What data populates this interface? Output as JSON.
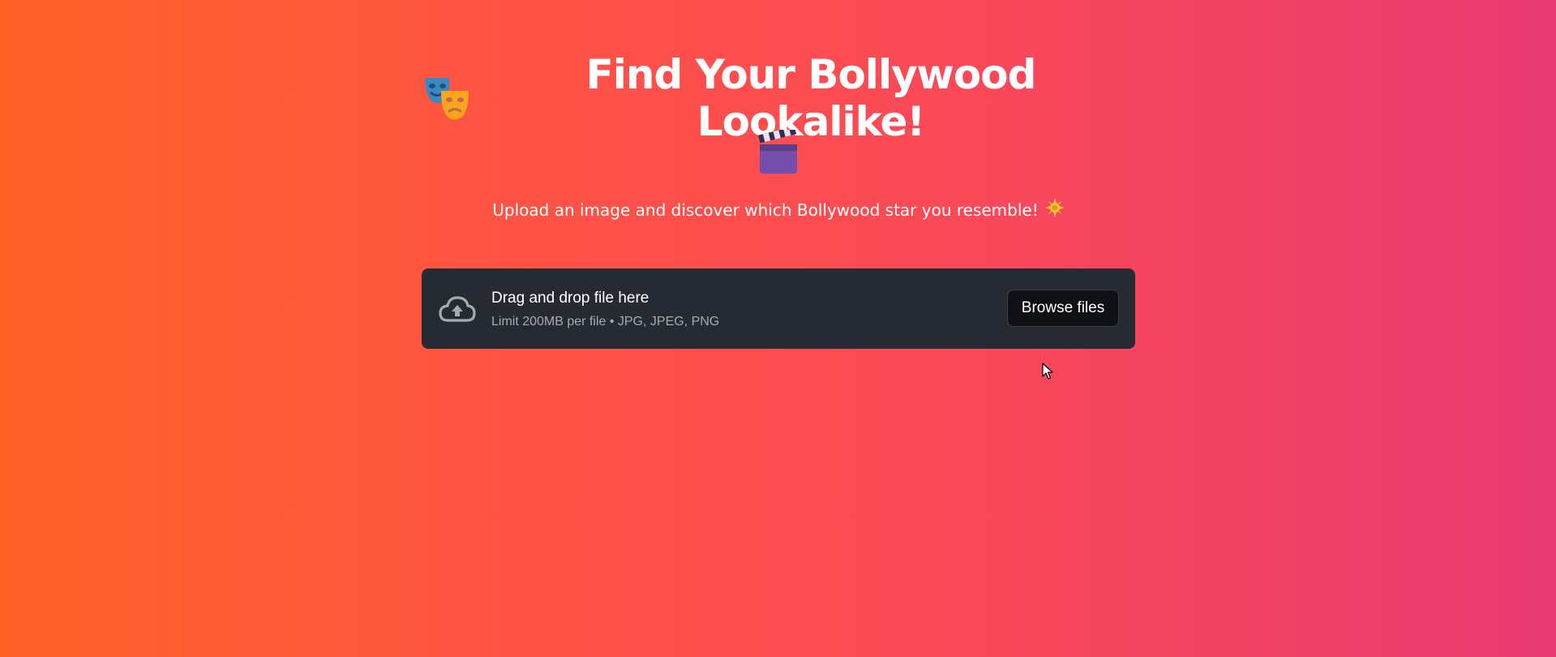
{
  "header": {
    "title": "Find Your Bollywood Lookalike!",
    "title_icon": "performing-arts-masks-icon",
    "title_trailing_icon": "clapper-board-icon"
  },
  "subtitle": {
    "text": "Upload an image and discover which Bollywood star you resemble!",
    "icon": "sun-icon"
  },
  "uploader": {
    "icon": "cloud-upload-icon",
    "title": "Drag and drop file here",
    "hint": "Limit 200MB per file • JPG, JPEG, PNG",
    "button_label": "Browse files"
  },
  "colors": {
    "background_start": "#ff6228",
    "background_end": "#e83a72",
    "uploader_bg": "#262a33",
    "button_bg": "#0f1116"
  }
}
